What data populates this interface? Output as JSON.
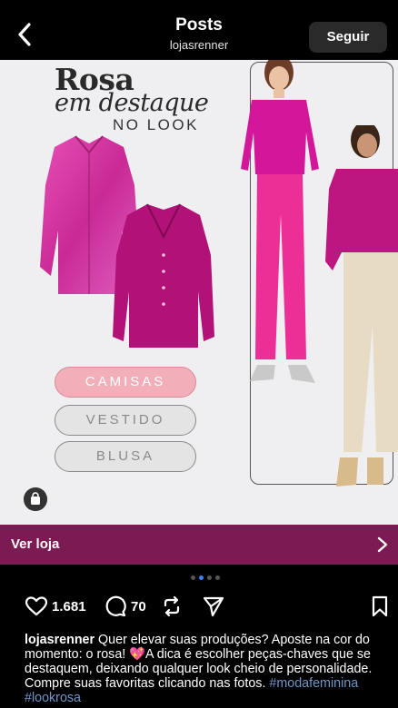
{
  "header": {
    "title": "Posts",
    "subtitle": "lojasrenner",
    "follow_label": "Seguir"
  },
  "post_image": {
    "headline_line1": "Rosa",
    "headline_line2": "em destaque",
    "headline_line3": "NO LOOK",
    "pills": [
      "CAMISAS",
      "VESTIDO",
      "BLUSA"
    ]
  },
  "shop_bar": {
    "label": "Ver loja"
  },
  "carousel": {
    "total": 4,
    "active": 1
  },
  "actions": {
    "likes": "1.681",
    "comments": "70"
  },
  "caption": {
    "username": "lojasrenner",
    "text_part1": " Quer elevar suas produções? Aposte na cor do momento: o rosa! ",
    "emoji": "💖",
    "text_part2": "A dica é escolher peças-chaves que se destaquem, deixando qualquer look cheio de personalidade. Compre suas favoritas clicando nas fotos. ",
    "hashtags": "#modafeminina #lookrosa"
  },
  "colors": {
    "accent_shop_bar": "#7c1a53",
    "camisas_pill": "#f2aeb9",
    "hashtag": "#6e97c9",
    "carousel_active": "#3b82f6"
  }
}
